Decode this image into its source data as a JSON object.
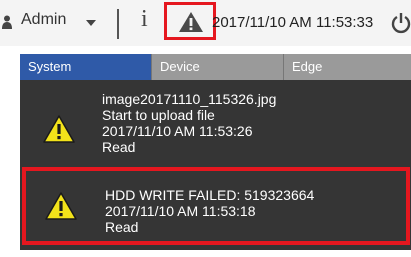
{
  "header": {
    "user_label": "Admin",
    "datetime": "2017/11/10 AM 11:53:33",
    "icons": [
      "user-icon",
      "chevron-down-icon",
      "info-icon",
      "alert-icon",
      "power-icon"
    ]
  },
  "tabs": [
    {
      "label": "System",
      "active": true
    },
    {
      "label": "Device",
      "active": false
    },
    {
      "label": "Edge",
      "active": false
    }
  ],
  "messages": [
    {
      "icon": "warning-icon",
      "lines": [
        "image20171110_115326.jpg",
        "Start to upload file",
        "2017/11/10 AM 11:53:26",
        "Read"
      ],
      "highlighted": false
    },
    {
      "icon": "warning-icon",
      "lines": [
        "HDD WRITE FAILED: 519323664",
        "2017/11/10 AM 11:53:18",
        "Read"
      ],
      "highlighted": true
    }
  ],
  "colors": {
    "highlight": "#e5171f",
    "active_tab": "#2f5aa8",
    "inactive_tab": "#9a9a9a",
    "panel": "#353535",
    "warning": "#f2e21a"
  }
}
